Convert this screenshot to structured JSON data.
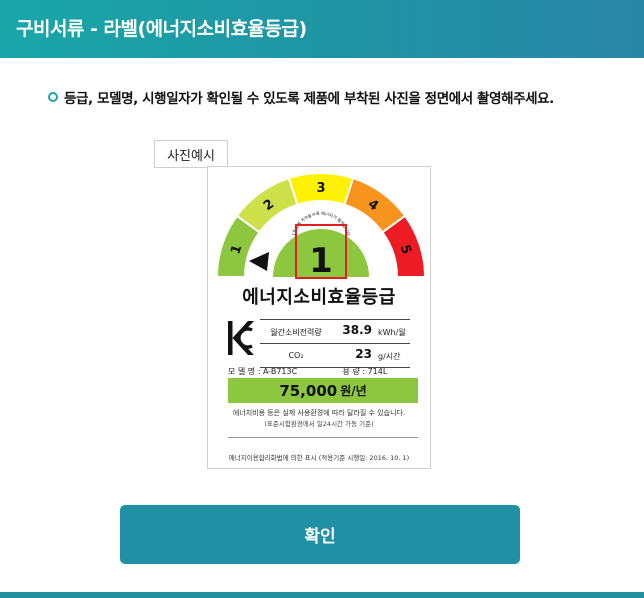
{
  "modal": {
    "title": "구비서류 - 라벨(에너지소비효율등급)",
    "instruction": "등급, 모델명, 시행일자가 확인될 수 있도록 제품에 부착된 사진을 정면에서 촬영해주세요.",
    "example_tag": "사진예시",
    "confirm_label": "확인"
  },
  "label": {
    "grades": [
      "1",
      "2",
      "3",
      "4",
      "5"
    ],
    "grade_colors": [
      "#8dc63f",
      "#cfe14a",
      "#fff200",
      "#f7941d",
      "#ed1c24"
    ],
    "current_grade": "1",
    "arc_text": "1등급에 가까울수록 에너지가 절약됩니다",
    "title": "에너지소비효율등급",
    "monthly_label": "월간소비전력량",
    "monthly_value": "38.9",
    "monthly_unit": "kWh/월",
    "co2_label": "CO₂",
    "co2_value": "23",
    "co2_unit": "g/시간",
    "model_text": "모 델 명 : A-B713C",
    "capacity_text": "용  량 : 714L",
    "cost_value": "75,000",
    "cost_unit": "원/년",
    "note1": "에너지비용 등은 실제 사용환경에 따라 달라질 수 있습니다.",
    "note2": "(표준시험환경에서 일24시간 가동 기준)",
    "law_note": "에너지이용합리화법에 의한 표시 (적용기준 시행일: 2016. 10. 1)"
  }
}
